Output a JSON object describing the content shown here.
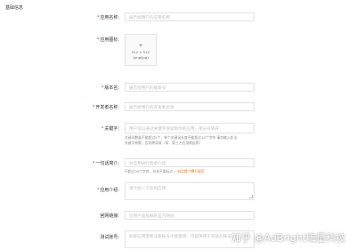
{
  "section_title": "基础信息",
  "fields": {
    "app_name": {
      "label": "应用名称:",
      "required": "*",
      "placeholder": "展示给用户的应用名称",
      "count": "0/32"
    },
    "app_icon": {
      "label": "应用图标:",
      "required": "*",
      "upload_plus": "+",
      "upload_size": "512 × 512",
      "upload_format": "(png/jpg)"
    },
    "version": {
      "label": "版本名:",
      "required": "*",
      "placeholder": "展示给用户的版本号"
    },
    "developer": {
      "label": "开发者名称:",
      "required": "*",
      "placeholder": "展示给用户的开发者名称"
    },
    "keywords": {
      "label": "关键字:",
      "required": "*",
      "placeholder": "用户可以通过关键字搜索到你的应用，用分号隔开",
      "hint_line1": "关键词数量不能超过5个，单个关键词长度不能超过10个字符 请勿输入非法",
      "hint_line2": "关键字参数，否则将导致（如：第三方应用商店等）"
    },
    "one_liner": {
      "label": "一句话简介:",
      "required": "*",
      "placeholder": "对应用进行简单介绍",
      "hint_prefix": "不超过34个字符，句末不要标点 ",
      "hint_link": "一句话提介撰写规范"
    },
    "intro": {
      "label": "应用介绍:",
      "required": "*",
      "placeholder": "请介绍一下您的应用"
    },
    "website": {
      "label": "官网链接:",
      "placeholder": "应用产品加载的官方网站"
    },
    "test_account": {
      "label": "测试账号:",
      "placeholder": "如果应用需要注册账号才能使用，可提供用于测试的账号"
    }
  },
  "watermark": "知乎 @AdBright嗨量科技"
}
